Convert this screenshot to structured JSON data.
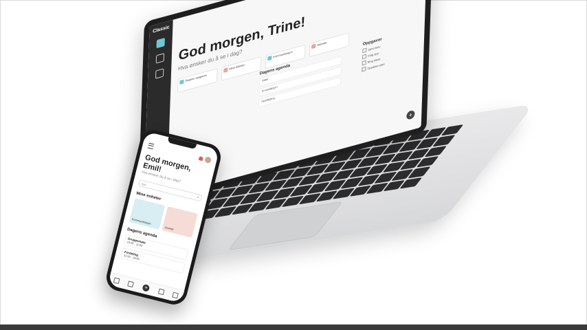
{
  "laptop": {
    "app_name": "Classic",
    "greeting": "God morgen, Trine!",
    "subtitle": "Hva ønsker du å se i dag?",
    "cards": [
      "Dagens oppgaver",
      "Mine klienter",
      "Kommunikasjon",
      "Aktivitet"
    ],
    "agenda_title": "Dagens agenda",
    "agenda_items": [
      "Møte",
      "Konsultasjon",
      "Oppfølging"
    ],
    "side_title": "Oppgaver",
    "side_items": [
      "Send brev",
      "Følg opp",
      "Ring klient",
      "Oppdater plan"
    ],
    "fab_label": "+"
  },
  "phone": {
    "greeting": "God morgen, Emil!",
    "subtitle": "Hva ønsker du å se i dag?",
    "search_placeholder": "Søk",
    "section_mine": "Mine enheter",
    "tile_1": "Kommunikasjon",
    "tile_2": "Journal",
    "section_agenda": "Dagens agenda",
    "agenda_1_title": "Gruppemøte",
    "agenda_1_time": "10:00 - 11:00",
    "agenda_2_title": "Fordeling",
    "agenda_2_time": "12:00 - 13:00",
    "nav_plus": "+"
  }
}
